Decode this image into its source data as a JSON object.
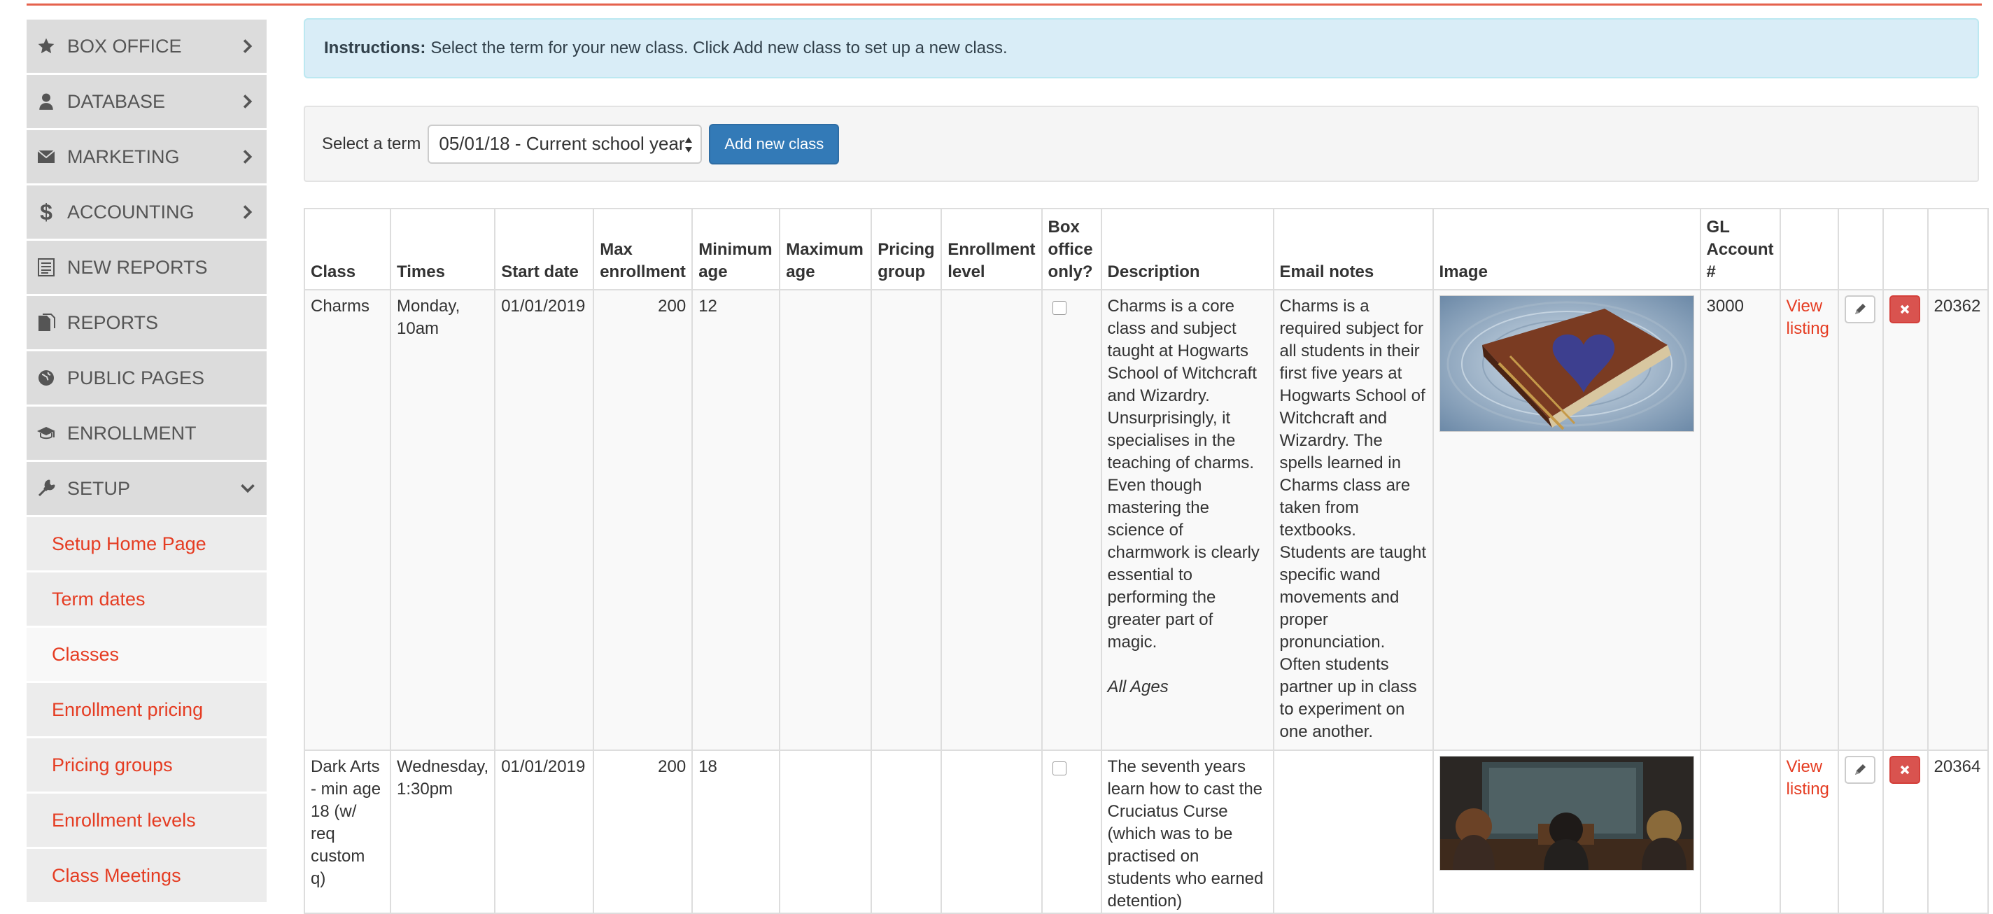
{
  "sidebar": {
    "items": [
      {
        "label": "BOX OFFICE",
        "icon": "star-icon"
      },
      {
        "label": "DATABASE",
        "icon": "user-icon"
      },
      {
        "label": "MARKETING",
        "icon": "envelope-icon"
      },
      {
        "label": "ACCOUNTING",
        "icon": "dollar-icon"
      },
      {
        "label": "NEW REPORTS",
        "icon": "list-icon"
      },
      {
        "label": "REPORTS",
        "icon": "document-icon"
      },
      {
        "label": "PUBLIC PAGES",
        "icon": "globe-icon"
      },
      {
        "label": "ENROLLMENT",
        "icon": "graduation-cap-icon"
      },
      {
        "label": "SETUP",
        "icon": "wrench-icon"
      }
    ],
    "setup_subitems": [
      "Setup Home Page",
      "Term dates",
      "Classes",
      "Enrollment pricing",
      "Pricing groups",
      "Enrollment levels",
      "Class Meetings"
    ],
    "active_subitem": "Classes"
  },
  "instructions": {
    "label": "Instructions:",
    "text": "Select the term for your new class. Click Add new class to set up a new class."
  },
  "term_bar": {
    "select_label": "Select a term",
    "selected_term": "05/01/18 - Current school year",
    "add_button": "Add new class"
  },
  "table": {
    "headers": {
      "class": "Class",
      "times": "Times",
      "start_date": "Start date",
      "max_enrollment": "Max enrollment",
      "minimum_age": "Minimum age",
      "maximum_age": "Maximum age",
      "pricing_group": "Pricing group",
      "enrollment_level": "Enrollment level",
      "box_office_only": "Box office only?",
      "description": "Description",
      "email_notes": "Email notes",
      "image": "Image",
      "gl_account": "GL Account #"
    },
    "rows": [
      {
        "class": "Charms",
        "times": "Monday, 10am",
        "start_date": "01/01/2019",
        "max_enrollment": "200",
        "minimum_age": "12",
        "maximum_age": "",
        "pricing_group": "",
        "enrollment_level": "",
        "box_office_only": false,
        "description": "Charms is a core class and subject taught at Hogwarts School of Witchcraft and Wizardry. Unsurprisingly, it specialises in the teaching of charms. Even though mastering the science of charmwork is clearly essential to performing the greater part of magic.",
        "description_tag": "All Ages",
        "email_notes": "Charms is a required subject for all students in their first five years at Hogwarts School of Witchcraft and Wizardry. The spells learned in Charms class are taken from textbooks. Students are taught specific wand movements and proper pronunciation. Often students partner up in class to experiment on one another.",
        "gl_account": "3000",
        "view_link": "View listing",
        "id": "20362"
      },
      {
        "class": "Dark Arts - min age 18 (w/ req custom q)",
        "times": "Wednesday, 1:30pm",
        "start_date": "01/01/2019",
        "max_enrollment": "200",
        "minimum_age": "18",
        "maximum_age": "",
        "pricing_group": "",
        "enrollment_level": "",
        "box_office_only": false,
        "description": "The seventh years learn how to cast the Cruciatus Curse (which was to be practised on students who earned detention)",
        "description_tag": "",
        "email_notes": "",
        "gl_account": "",
        "view_link": "View listing",
        "id": "20364"
      }
    ]
  },
  "colors": {
    "accent_red": "#e53c22",
    "primary_blue": "#337ab7",
    "danger_red": "#d9534f",
    "info_bg": "#d9edf7",
    "sidebar_bg": "#dcdcdc"
  }
}
